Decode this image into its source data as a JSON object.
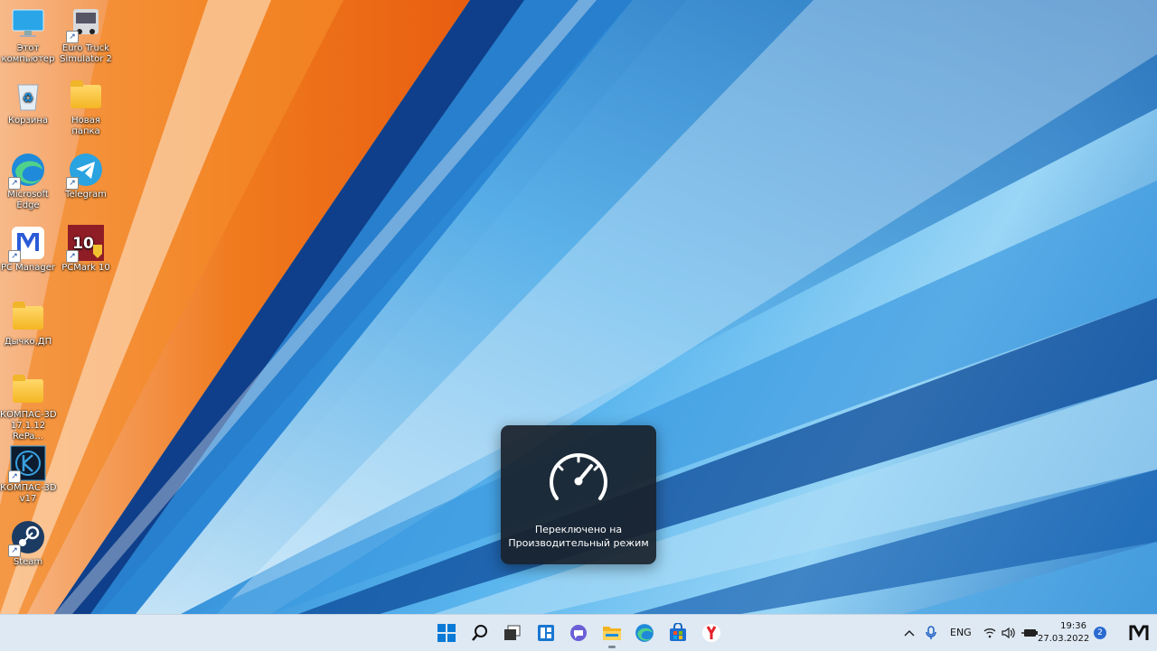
{
  "desktop": {
    "icons": [
      {
        "label": "Этот\nкомпьютер",
        "icon": "monitor-icon"
      },
      {
        "label": "Euro Truck\nSimulator 2",
        "icon": "truck-icon"
      },
      {
        "label": "Корзина",
        "icon": "recycle-bin-icon"
      },
      {
        "label": "Новая папка",
        "icon": "folder-icon"
      },
      {
        "label": "Microsoft\nEdge",
        "icon": "edge-icon"
      },
      {
        "label": "Telegram",
        "icon": "telegram-icon"
      },
      {
        "label": "PC Manager",
        "icon": "pc-manager-icon"
      },
      {
        "label": "PCMark 10",
        "icon": "pcmark-icon",
        "badge": "10"
      },
      {
        "label": "Дычко,ДП",
        "icon": "folder-icon"
      },
      {
        "label": "КОМПАС-3D\n17.1.12 RePa...",
        "icon": "folder-icon"
      },
      {
        "label": "КОМПАС-3D\nv17",
        "icon": "kompas-icon"
      },
      {
        "label": "Steam",
        "icon": "steam-icon"
      }
    ]
  },
  "toast": {
    "icon": "speedometer-icon",
    "line1": "Переключено на",
    "line2": "Производительный режим"
  },
  "taskbar": {
    "apps": [
      "start-icon",
      "search-icon",
      "task-view-icon",
      "widgets-icon",
      "teams-chat-icon",
      "file-explorer-icon",
      "edge-icon",
      "store-icon",
      "yandex-browser-icon"
    ],
    "tray": {
      "language": "ENG",
      "time": "19:36",
      "date": "27.03.2022",
      "notifications": "2"
    }
  },
  "colors": {
    "taskbar_bg": "#dfe9f3",
    "toast_bg": "#19212a",
    "accent": "#2a6bd1"
  }
}
